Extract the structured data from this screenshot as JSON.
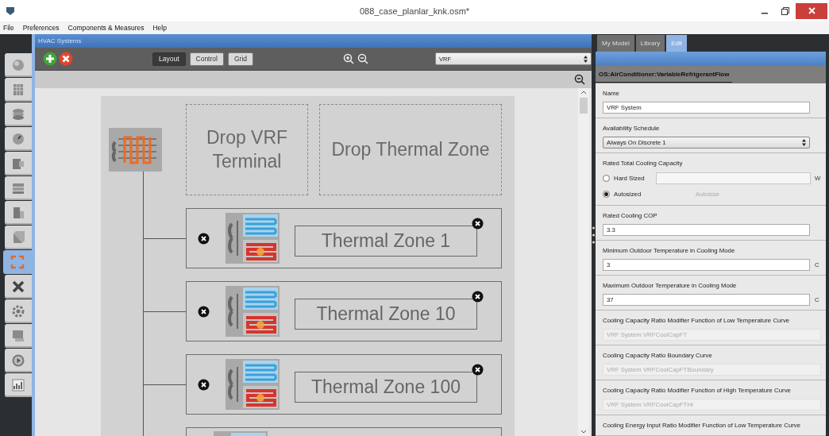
{
  "window": {
    "title": "088_case_planlar_knk.osm*"
  },
  "menu": [
    "File",
    "Preferences",
    "Components & Measures",
    "Help"
  ],
  "sidebar": {
    "tabs": [
      {
        "selected": false
      },
      {
        "selected": false
      },
      {
        "selected": false
      },
      {
        "selected": false
      },
      {
        "selected": false
      },
      {
        "selected": false
      },
      {
        "selected": false
      },
      {
        "selected": false
      },
      {
        "selected": true
      },
      {
        "selected": false
      },
      {
        "selected": false
      },
      {
        "selected": false
      },
      {
        "selected": false
      },
      {
        "selected": false
      }
    ]
  },
  "hvac": {
    "title": "HVAC Systems",
    "modes": [
      {
        "label": "Layout",
        "selected": true
      },
      {
        "label": "Control",
        "selected": false
      },
      {
        "label": "Grid",
        "selected": false
      }
    ],
    "system": "VRF",
    "diagram": {
      "drop_targets": [
        "Drop VRF Terminal",
        "Drop Thermal Zone"
      ],
      "zones": [
        {
          "label": "Thermal Zone 1"
        },
        {
          "label": "Thermal Zone 10"
        },
        {
          "label": "Thermal Zone 100"
        }
      ]
    }
  },
  "inspector": {
    "tabs": [
      {
        "label": "My Model",
        "selected": false
      },
      {
        "label": "Library",
        "selected": false
      },
      {
        "label": "Edit",
        "selected": true
      }
    ],
    "object_type": "OS:AirConditioner:VariableRefrigerantFlow",
    "fields": [
      {
        "kind": "text",
        "label": "Name",
        "value": "VRF System"
      },
      {
        "kind": "select",
        "label": "Availability Schedule",
        "value": "Always On Discrete 1"
      },
      {
        "kind": "radio",
        "label": "Rated Total Cooling Capacity",
        "options": [
          {
            "label": "Hard Sized",
            "selected": false,
            "unit": "W"
          },
          {
            "label": "Autosized",
            "selected": true,
            "note": "Autosize"
          }
        ]
      },
      {
        "kind": "text",
        "label": "Rated Cooling COP",
        "value": "3.3"
      },
      {
        "kind": "text",
        "label": "Minimum Outdoor Temperature in Cooling Mode",
        "value": "3",
        "unit": "C"
      },
      {
        "kind": "text",
        "label": "Maximum Outdoor Temperature in Cooling Mode",
        "value": "37",
        "unit": "C"
      },
      {
        "kind": "readonly",
        "label": "Cooling Capacity Ratio Modifier Function of Low Temperature Curve",
        "value": "VRF System VRFCoolCapFT"
      },
      {
        "kind": "readonly",
        "label": "Cooling Capacity Ratio Boundary Curve",
        "value": "VRF System VRFCoolCapFTBoundary"
      },
      {
        "kind": "readonly",
        "label": "Cooling Capacity Ratio Modifier Function of High Temperature Curve",
        "value": "VRF System VRFCoolCapFTHi"
      },
      {
        "kind": "label",
        "label": "Cooling Energy Input Ratio Modifier Function of Low Temperature Curve"
      }
    ]
  }
}
